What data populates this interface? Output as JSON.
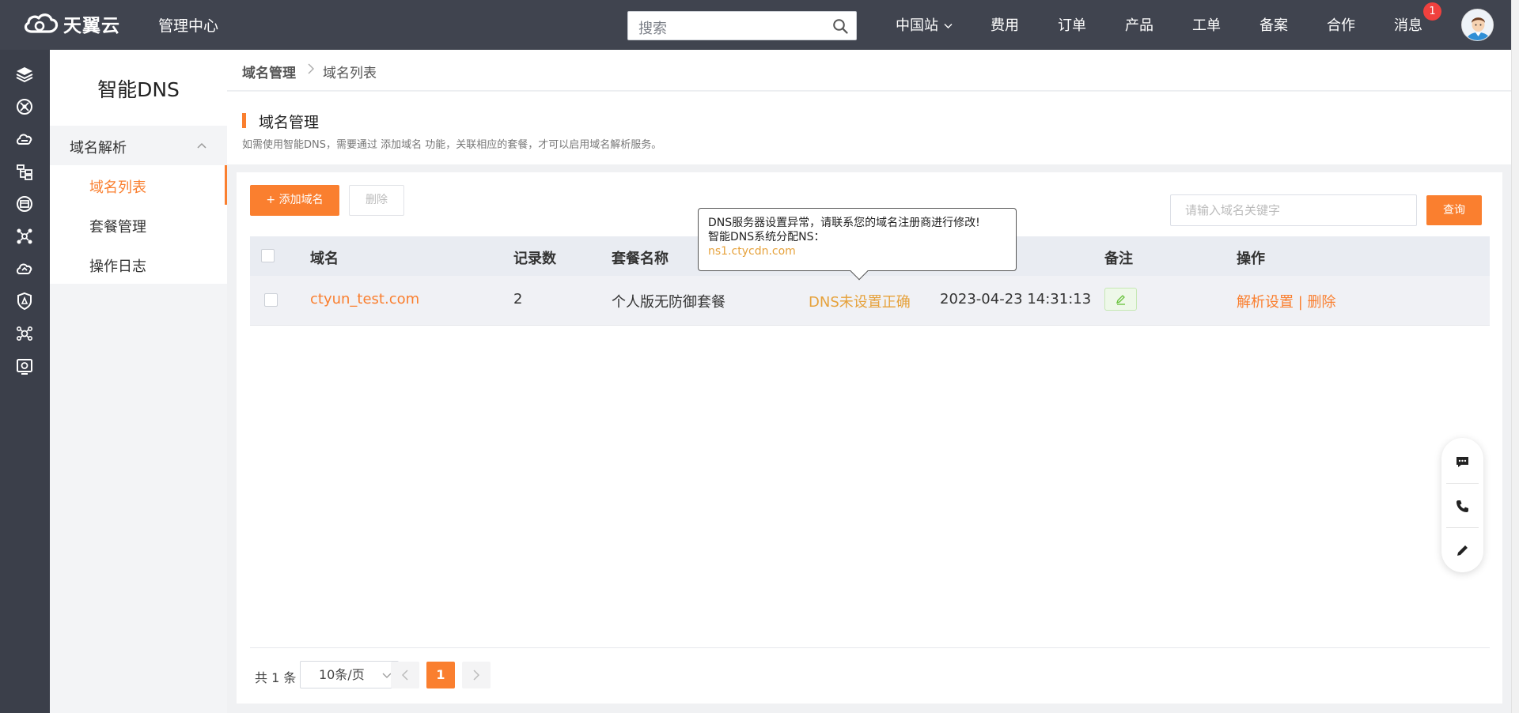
{
  "topbar": {
    "logo_text": "天翼云",
    "mgmt_label": "管理中心",
    "search_placeholder": "搜索",
    "nav": [
      "中国站",
      "费用",
      "订单",
      "产品",
      "工单",
      "备案",
      "合作",
      "消息"
    ],
    "message_badge": "1"
  },
  "sidebar": {
    "title": "智能DNS",
    "group_label": "域名解析",
    "items": [
      "域名列表",
      "套餐管理",
      "操作日志"
    ],
    "active_index": 0
  },
  "breadcrumb": {
    "level1": "域名管理",
    "level2": "域名列表"
  },
  "page": {
    "title": "域名管理",
    "description": "如需使用智能DNS，需要通过 添加域名 功能，关联相应的套餐，才可以启用域名解析服务。"
  },
  "toolbar": {
    "add_label": "+ 添加域名",
    "delete_label": "删除",
    "keyword_placeholder": "请输入域名关键字",
    "query_label": "查询"
  },
  "table": {
    "headers": [
      "域名",
      "记录数",
      "套餐名称",
      "备注",
      "操作"
    ],
    "rows": [
      {
        "domain": "ctyun_test.com",
        "records": "2",
        "plan": "个人版无防御套餐",
        "status": "DNS未设置正确",
        "created": "2023-04-23 14:31:13",
        "op_parse": "解析设置",
        "op_sep": "|",
        "op_delete": "删除"
      }
    ]
  },
  "tooltip": {
    "line1": "DNS服务器设置异常，请联系您的域名注册商进行修改!",
    "line2": "智能DNS系统分配NS：",
    "ns": "ns1.ctycdn.com"
  },
  "pager": {
    "total": "共 1 条",
    "page_size": "10条/页",
    "current": "1"
  },
  "colors": {
    "accent": "#fa7f2f",
    "topbar": "#40444f",
    "rail": "#3b3f4a",
    "warning": "#e6a23c"
  }
}
